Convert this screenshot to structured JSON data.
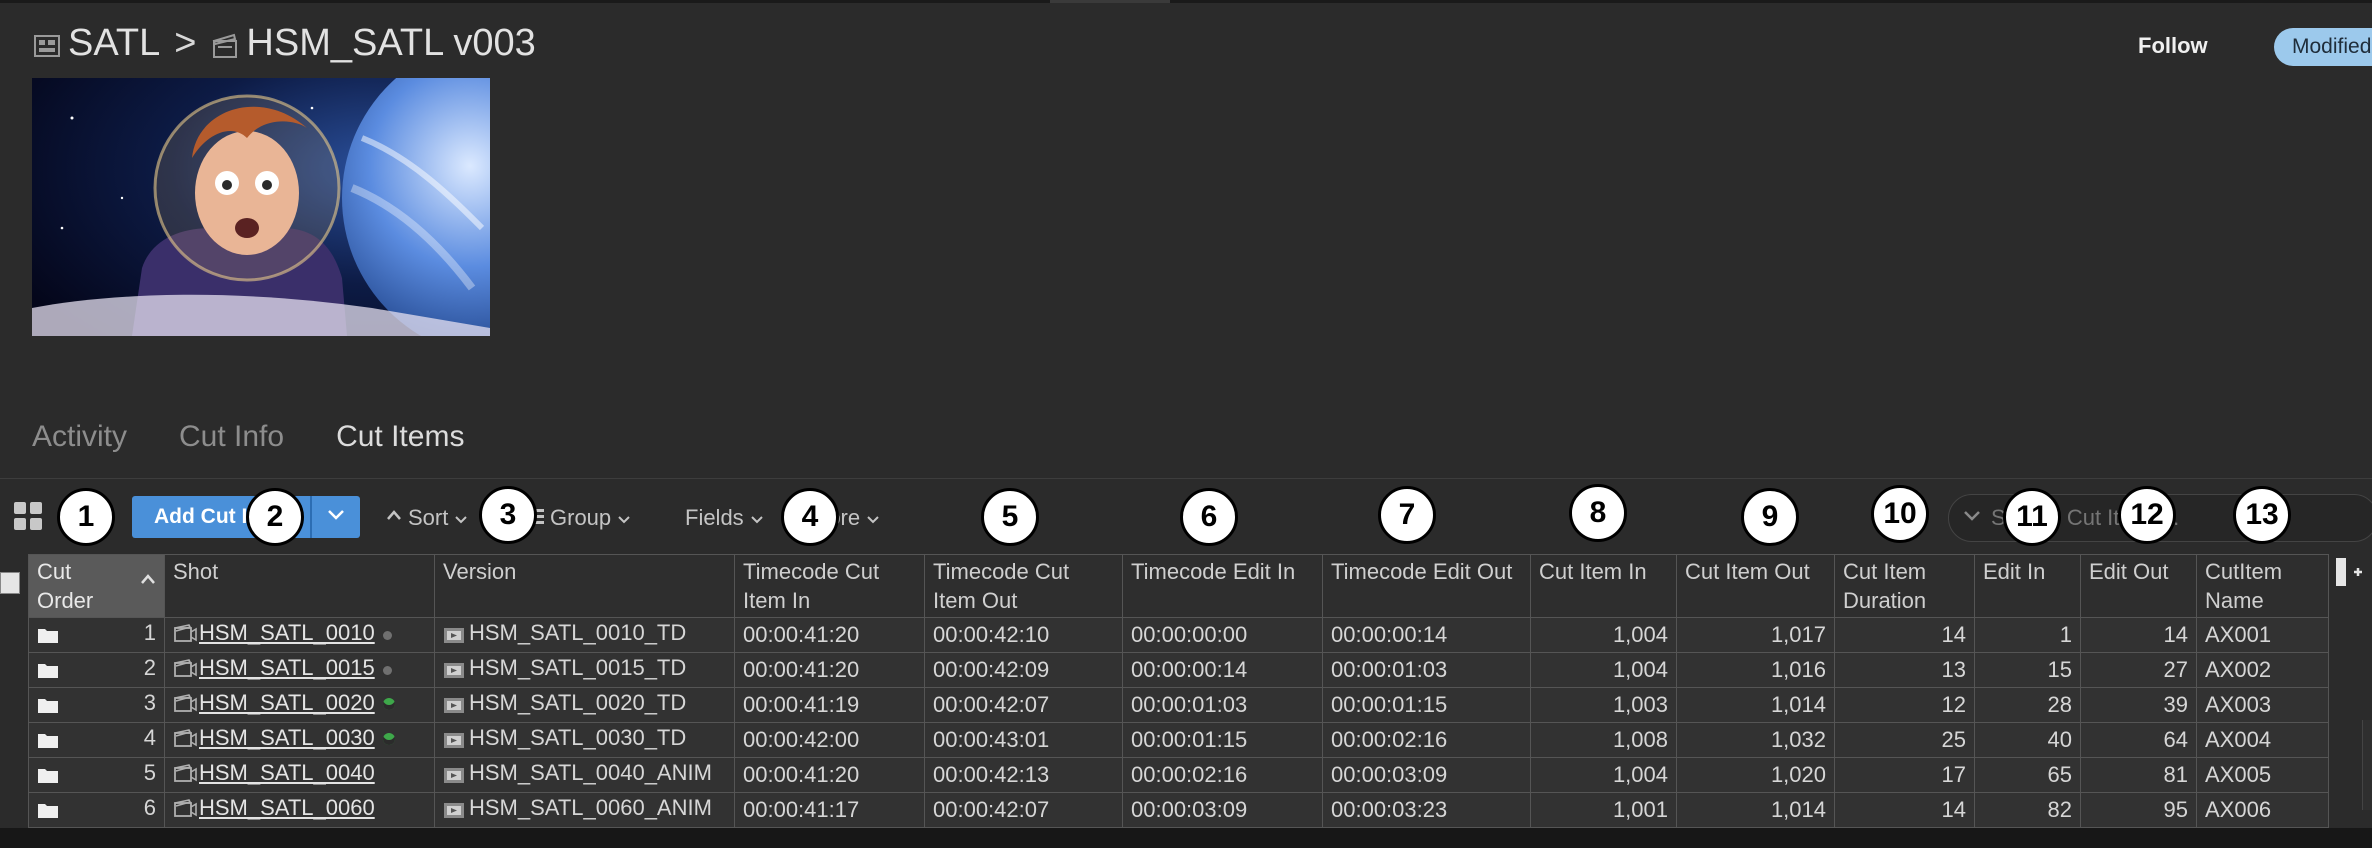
{
  "breadcrumb": {
    "project": "SATL",
    "separator": ">",
    "cut": "HSM_SATL v003"
  },
  "header": {
    "follow_label": "Follow",
    "status_badge": "Modified"
  },
  "thumbnail": {
    "alt": "Astronaut character in space helmet with planet"
  },
  "tabs": [
    {
      "label": "Activity",
      "active": false
    },
    {
      "label": "Cut Info",
      "active": false
    },
    {
      "label": "Cut Items",
      "active": true
    }
  ],
  "toolbar": {
    "add_button_label": "Add Cut Item",
    "sort_label": "Sort",
    "group_label": "Group",
    "fields_label": "Fields",
    "more_label": "More",
    "search_placeholder": "Search Cut Items..."
  },
  "callouts": [
    "1",
    "2",
    "3",
    "4",
    "5",
    "6",
    "7",
    "8",
    "9",
    "10",
    "11",
    "12",
    "13"
  ],
  "table": {
    "columns": [
      {
        "label": "Cut Order"
      },
      {
        "label": "Shot"
      },
      {
        "label": "Version"
      },
      {
        "label": "Timecode Cut Item In"
      },
      {
        "label": "Timecode Cut Item Out"
      },
      {
        "label": "Timecode Edit In"
      },
      {
        "label": "Timecode Edit Out"
      },
      {
        "label": "Cut Item In"
      },
      {
        "label": "Cut Item Out"
      },
      {
        "label": "Cut Item Duration"
      },
      {
        "label": "Edit In"
      },
      {
        "label": "Edit Out"
      },
      {
        "label": "CutItem Name"
      }
    ],
    "rows": [
      {
        "order": "1",
        "shot": "HSM_SATL_0010",
        "shot_status": "gray",
        "version": "HSM_SATL_0010_TD",
        "tc_cut_in": "00:00:41:20",
        "tc_cut_out": "00:00:42:10",
        "tc_edit_in": "00:00:00:00",
        "tc_edit_out": "00:00:00:14",
        "cut_in": "1,004",
        "cut_out": "1,017",
        "duration": "14",
        "edit_in": "1",
        "edit_out": "14",
        "name": "AX001"
      },
      {
        "order": "2",
        "shot": "HSM_SATL_0015",
        "shot_status": "gray",
        "version": "HSM_SATL_0015_TD",
        "tc_cut_in": "00:00:41:20",
        "tc_cut_out": "00:00:42:09",
        "tc_edit_in": "00:00:00:14",
        "tc_edit_out": "00:00:01:03",
        "cut_in": "1,004",
        "cut_out": "1,016",
        "duration": "13",
        "edit_in": "15",
        "edit_out": "27",
        "name": "AX002"
      },
      {
        "order": "3",
        "shot": "HSM_SATL_0020",
        "shot_status": "green",
        "version": "HSM_SATL_0020_TD",
        "tc_cut_in": "00:00:41:19",
        "tc_cut_out": "00:00:42:07",
        "tc_edit_in": "00:00:01:03",
        "tc_edit_out": "00:00:01:15",
        "cut_in": "1,003",
        "cut_out": "1,014",
        "duration": "12",
        "edit_in": "28",
        "edit_out": "39",
        "name": "AX003"
      },
      {
        "order": "4",
        "shot": "HSM_SATL_0030",
        "shot_status": "green",
        "version": "HSM_SATL_0030_TD",
        "tc_cut_in": "00:00:42:00",
        "tc_cut_out": "00:00:43:01",
        "tc_edit_in": "00:00:01:15",
        "tc_edit_out": "00:00:02:16",
        "cut_in": "1,008",
        "cut_out": "1,032",
        "duration": "25",
        "edit_in": "40",
        "edit_out": "64",
        "name": "AX004"
      },
      {
        "order": "5",
        "shot": "HSM_SATL_0040",
        "shot_status": "none",
        "version": "HSM_SATL_0040_ANIM",
        "tc_cut_in": "00:00:41:20",
        "tc_cut_out": "00:00:42:13",
        "tc_edit_in": "00:00:02:16",
        "tc_edit_out": "00:00:03:09",
        "cut_in": "1,004",
        "cut_out": "1,020",
        "duration": "17",
        "edit_in": "65",
        "edit_out": "81",
        "name": "AX005"
      },
      {
        "order": "6",
        "shot": "HSM_SATL_0060",
        "shot_status": "none",
        "version": "HSM_SATL_0060_ANIM",
        "tc_cut_in": "00:00:41:17",
        "tc_cut_out": "00:00:42:07",
        "tc_edit_in": "00:00:03:09",
        "tc_edit_out": "00:00:03:23",
        "cut_in": "1,001",
        "cut_out": "1,014",
        "duration": "14",
        "edit_in": "82",
        "edit_out": "95",
        "name": "AX006"
      }
    ]
  },
  "colors": {
    "accent": "#4a90d9",
    "badge": "#9cc9ec",
    "status_green": "#3ea84a",
    "status_gray": "#707070"
  }
}
